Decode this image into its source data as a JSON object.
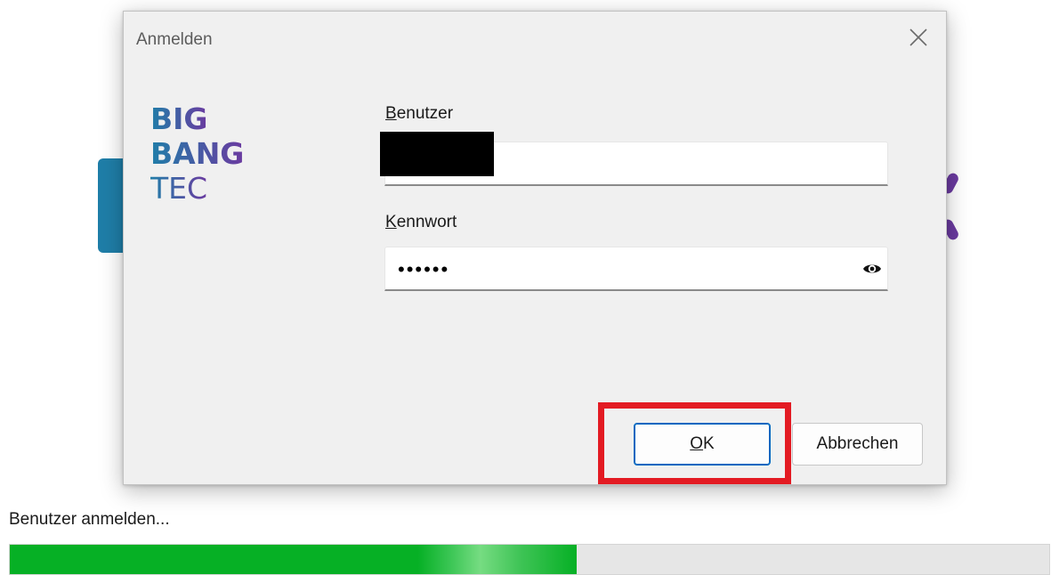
{
  "dialog": {
    "title": "Anmelden",
    "close_icon": "close-icon",
    "logo": {
      "line1": "BIG",
      "line2": "BANG",
      "line3": "TEC",
      "colors": {
        "blue": "#1f7ea8",
        "purple": "#6b3aa0"
      }
    },
    "user": {
      "label_accel": "B",
      "label_rest": "enutzer",
      "value_redacted": true
    },
    "password": {
      "label_accel": "K",
      "label_rest": "ennwort",
      "masked_value": "••••••",
      "reveal_icon": "eye-icon"
    },
    "buttons": {
      "ok_accel": "O",
      "ok_rest": "K",
      "cancel": "Abbrechen"
    }
  },
  "status": {
    "text": "Benutzer anmelden...",
    "progress": 0.545,
    "progress_color": "#06b025"
  },
  "annotation": {
    "highlight_color": "#e31b23"
  }
}
